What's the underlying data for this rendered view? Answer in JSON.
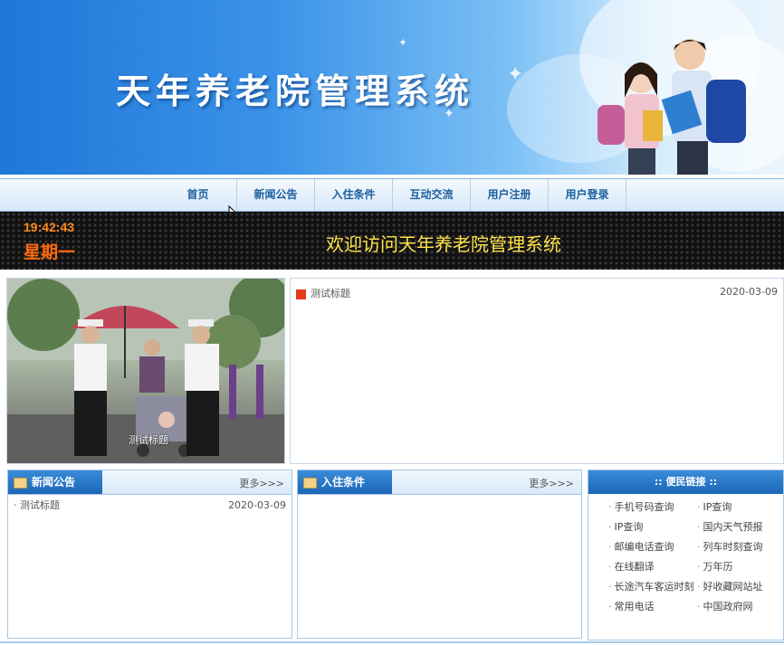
{
  "banner": {
    "title": "天年养老院管理系统"
  },
  "nav": {
    "items": [
      "首页",
      "新闻公告",
      "入住条件",
      "互动交流",
      "用户注册",
      "用户登录"
    ]
  },
  "led": {
    "time": "19:42:43",
    "weekday": "星期一",
    "welcome": "欢迎访问天年养老院管理系统"
  },
  "photo": {
    "caption": "测试标题"
  },
  "top_news": {
    "items": [
      {
        "title": "测试标题",
        "date": "2020-03-09"
      }
    ]
  },
  "news_panel": {
    "title": "新闻公告",
    "more": "更多>>>",
    "items": [
      {
        "title": "测试标题",
        "date": "2020-03-09"
      }
    ]
  },
  "checkin_panel": {
    "title": "入住条件",
    "more": "更多>>>"
  },
  "links_panel": {
    "title": ":: 便民链接 ::",
    "links": [
      "手机号码查询",
      "IP查询",
      "IP查询",
      "国内天气预报",
      "邮编电话查询",
      "列车时刻查询",
      "在线翻译",
      "万年历",
      "长途汽车客运时刻",
      "好收藏网站址",
      "常用电话",
      "中国政府网"
    ]
  },
  "colors": {
    "banner_blue": "#1f78d8",
    "nav_text": "#1b5fa0",
    "led_orange": "#ff8a1c",
    "led_yellow": "#ffe44a",
    "panel_tab": "#1b66b8",
    "news_icon": "#e23a1a"
  }
}
